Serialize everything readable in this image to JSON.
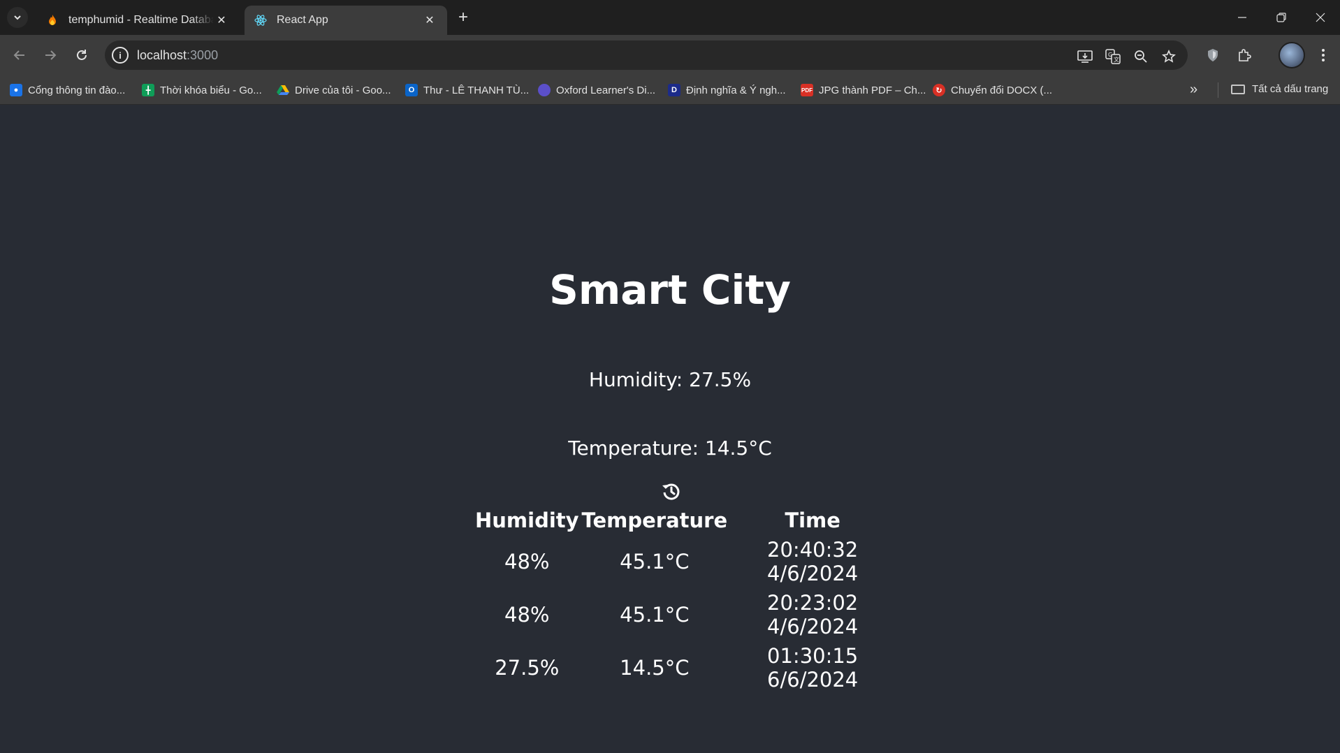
{
  "browser": {
    "tabs": [
      {
        "title": "temphumid - Realtime Database",
        "icon": "firebase-icon",
        "active": false
      },
      {
        "title": "React App",
        "icon": "react-icon",
        "active": true
      }
    ],
    "url_host": "localhost",
    "url_port": ":3000",
    "bookmarks": [
      {
        "label": "Cổng thông tin đào...",
        "icon": "portal-icon",
        "color": "#1a73e8"
      },
      {
        "label": "Thời khóa biểu - Go...",
        "icon": "sheets-icon",
        "color": "#0f9d58"
      },
      {
        "label": "Drive của tôi - Goo...",
        "icon": "drive-icon",
        "color": "#fbbc04"
      },
      {
        "label": "Thư - LÊ THANH TÙ...",
        "icon": "outlook-icon",
        "color": "#0a64c8"
      },
      {
        "label": "Oxford Learner's Di...",
        "icon": "oxford-icon",
        "color": "#5b4fc9"
      },
      {
        "label": "Định nghĩa & Ý ngh...",
        "icon": "dictionary-icon",
        "color": "#1c2b8a"
      },
      {
        "label": "JPG thành PDF – Ch...",
        "icon": "pdf-icon",
        "color": "#d93025"
      },
      {
        "label": "Chuyển đổi DOCX (...",
        "icon": "convert-icon",
        "color": "#d93025"
      }
    ],
    "all_bookmarks_label": "Tất cả dấu trang"
  },
  "app": {
    "title": "Smart City",
    "humidity_text": "Humidity: 27.5%",
    "temperature_text": "Temperature: 14.5°C",
    "history": {
      "headers": [
        "Humidity",
        "Temperature",
        "Time"
      ],
      "rows": [
        {
          "humidity": "48%",
          "temperature": "45.1°C",
          "time": "20:40:32 4/6/2024"
        },
        {
          "humidity": "48%",
          "temperature": "45.1°C",
          "time": "20:23:02 4/6/2024"
        },
        {
          "humidity": "27.5%",
          "temperature": "14.5°C",
          "time": "01:30:15 6/6/2024"
        }
      ]
    }
  }
}
